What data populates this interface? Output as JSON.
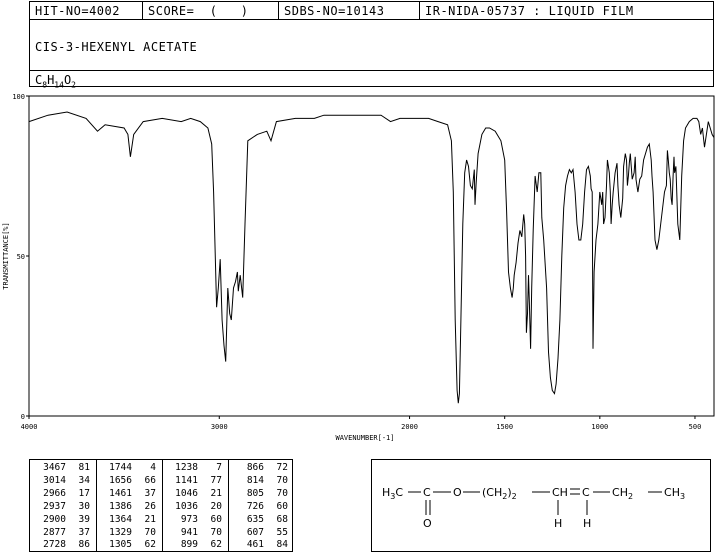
{
  "header": {
    "hit_no": "HIT-NO=4002",
    "score": "SCORE=  (   )",
    "sdbs_no": "SDBS-NO=10143",
    "ir_nida": "IR-NIDA-05737 : LIQUID FILM"
  },
  "compound_name": "CIS-3-HEXENYL ACETATE",
  "formula": {
    "c": "C",
    "c_n": "8",
    "h": "H",
    "h_n": "14",
    "o": "O",
    "o_n": "2"
  },
  "chart_data": {
    "type": "line",
    "xlabel": "WAVENUMBER[-1]",
    "ylabel": "TRANSMITTANCE[%]",
    "xlim": [
      4000,
      400
    ],
    "ylim": [
      0,
      100
    ],
    "x_ticks": [
      4000,
      3000,
      2000,
      1500,
      1000,
      500
    ],
    "y_ticks": [
      0,
      50,
      100
    ],
    "x": [
      4000,
      3900,
      3800,
      3700,
      3640,
      3600,
      3500,
      3480,
      3467,
      3450,
      3400,
      3300,
      3200,
      3150,
      3100,
      3060,
      3040,
      3030,
      3014,
      3005,
      2995,
      2985,
      2975,
      2966,
      2955,
      2945,
      2937,
      2925,
      2915,
      2905,
      2900,
      2890,
      2877,
      2865,
      2850,
      2800,
      2750,
      2728,
      2700,
      2600,
      2500,
      2450,
      2400,
      2300,
      2200,
      2150,
      2100,
      2050,
      2000,
      1950,
      1900,
      1850,
      1800,
      1780,
      1770,
      1760,
      1750,
      1744,
      1738,
      1730,
      1720,
      1710,
      1700,
      1690,
      1680,
      1670,
      1660,
      1656,
      1650,
      1640,
      1620,
      1600,
      1580,
      1550,
      1520,
      1500,
      1490,
      1480,
      1470,
      1461,
      1455,
      1450,
      1440,
      1430,
      1420,
      1410,
      1400,
      1395,
      1390,
      1386,
      1380,
      1375,
      1370,
      1364,
      1358,
      1350,
      1340,
      1329,
      1320,
      1310,
      1305,
      1295,
      1280,
      1270,
      1260,
      1250,
      1238,
      1230,
      1220,
      1210,
      1200,
      1190,
      1180,
      1170,
      1160,
      1150,
      1141,
      1130,
      1120,
      1110,
      1100,
      1090,
      1080,
      1070,
      1060,
      1050,
      1046,
      1040,
      1036,
      1030,
      1020,
      1010,
      1000,
      995,
      990,
      985,
      980,
      973,
      965,
      960,
      955,
      950,
      945,
      941,
      935,
      930,
      920,
      910,
      905,
      899,
      890,
      880,
      875,
      866,
      860,
      855,
      850,
      845,
      840,
      830,
      820,
      814,
      810,
      805,
      800,
      790,
      780,
      770,
      760,
      750,
      740,
      730,
      726,
      720,
      710,
      700,
      690,
      680,
      670,
      660,
      650,
      645,
      640,
      635,
      630,
      625,
      620,
      615,
      610,
      607,
      600,
      590,
      580,
      570,
      560,
      550,
      530,
      510,
      490,
      480,
      470,
      461,
      450,
      440,
      430,
      420,
      410,
      400
    ],
    "y": [
      92,
      94,
      95,
      93,
      89,
      91,
      90,
      88,
      81,
      88,
      92,
      93,
      92,
      93,
      92,
      90,
      85,
      70,
      34,
      40,
      49,
      30,
      22,
      17,
      40,
      32,
      30,
      40,
      42,
      45,
      39,
      44,
      37,
      60,
      86,
      88,
      89,
      86,
      92,
      93,
      93,
      94,
      94,
      94,
      94,
      94,
      92,
      93,
      93,
      93,
      93,
      92,
      91,
      86,
      70,
      30,
      8,
      4,
      7,
      30,
      60,
      76,
      80,
      78,
      72,
      71,
      77,
      66,
      73,
      82,
      88,
      90,
      90,
      89,
      86,
      80,
      64,
      45,
      40,
      37,
      40,
      44,
      48,
      54,
      58,
      56,
      63,
      60,
      50,
      26,
      32,
      44,
      35,
      21,
      40,
      58,
      75,
      70,
      76,
      76,
      62,
      55,
      40,
      20,
      12,
      8,
      7,
      10,
      18,
      30,
      50,
      65,
      72,
      75,
      77,
      76,
      77,
      70,
      60,
      55,
      55,
      60,
      70,
      77,
      78,
      75,
      71,
      70,
      21,
      45,
      55,
      60,
      70,
      68,
      66,
      70,
      60,
      62,
      72,
      80,
      78,
      76,
      70,
      60,
      66,
      70,
      76,
      79,
      72,
      66,
      62,
      68,
      78,
      82,
      80,
      72,
      75,
      79,
      82,
      74,
      76,
      81,
      74,
      72,
      70,
      74,
      75,
      80,
      82,
      84,
      85,
      80,
      75,
      70,
      55,
      52,
      55,
      60,
      65,
      70,
      72,
      83,
      80,
      76,
      74,
      68,
      66,
      75,
      81,
      76,
      78,
      60,
      55,
      75,
      86,
      90,
      92,
      93,
      93,
      92,
      88,
      90,
      84,
      88,
      92,
      90,
      88,
      87
    ]
  },
  "peaks": [
    {
      "wn": "3467",
      "t": "81"
    },
    {
      "wn": "3014",
      "t": "34"
    },
    {
      "wn": "2966",
      "t": "17"
    },
    {
      "wn": "2937",
      "t": "30"
    },
    {
      "wn": "2900",
      "t": "39"
    },
    {
      "wn": "2877",
      "t": "37"
    },
    {
      "wn": "2728",
      "t": "86"
    },
    {
      "wn": "1744",
      "t": "4"
    },
    {
      "wn": "1656",
      "t": "66"
    },
    {
      "wn": "1461",
      "t": "37"
    },
    {
      "wn": "1386",
      "t": "26"
    },
    {
      "wn": "1364",
      "t": "21"
    },
    {
      "wn": "1329",
      "t": "70"
    },
    {
      "wn": "1305",
      "t": "62"
    },
    {
      "wn": "1238",
      "t": "7"
    },
    {
      "wn": "1141",
      "t": "77"
    },
    {
      "wn": "1046",
      "t": "21"
    },
    {
      "wn": "1036",
      "t": "20"
    },
    {
      "wn": "973",
      "t": "60"
    },
    {
      "wn": "941",
      "t": "70"
    },
    {
      "wn": "899",
      "t": "62"
    },
    {
      "wn": "866",
      "t": "72"
    },
    {
      "wn": "814",
      "t": "70"
    },
    {
      "wn": "805",
      "t": "70"
    },
    {
      "wn": "726",
      "t": "60"
    },
    {
      "wn": "635",
      "t": "68"
    },
    {
      "wn": "607",
      "t": "55"
    },
    {
      "wn": "461",
      "t": "84"
    }
  ],
  "structure": {
    "h3c": "H3C",
    "c1": "C",
    "o_ester": "O",
    "o_carbonyl": "O",
    "chain": "(CH2)2",
    "ch_a": "CH",
    "ch_b": "C",
    "h_a": "H",
    "h_b": "H",
    "ch2": "CH2",
    "ch3": "CH3"
  }
}
